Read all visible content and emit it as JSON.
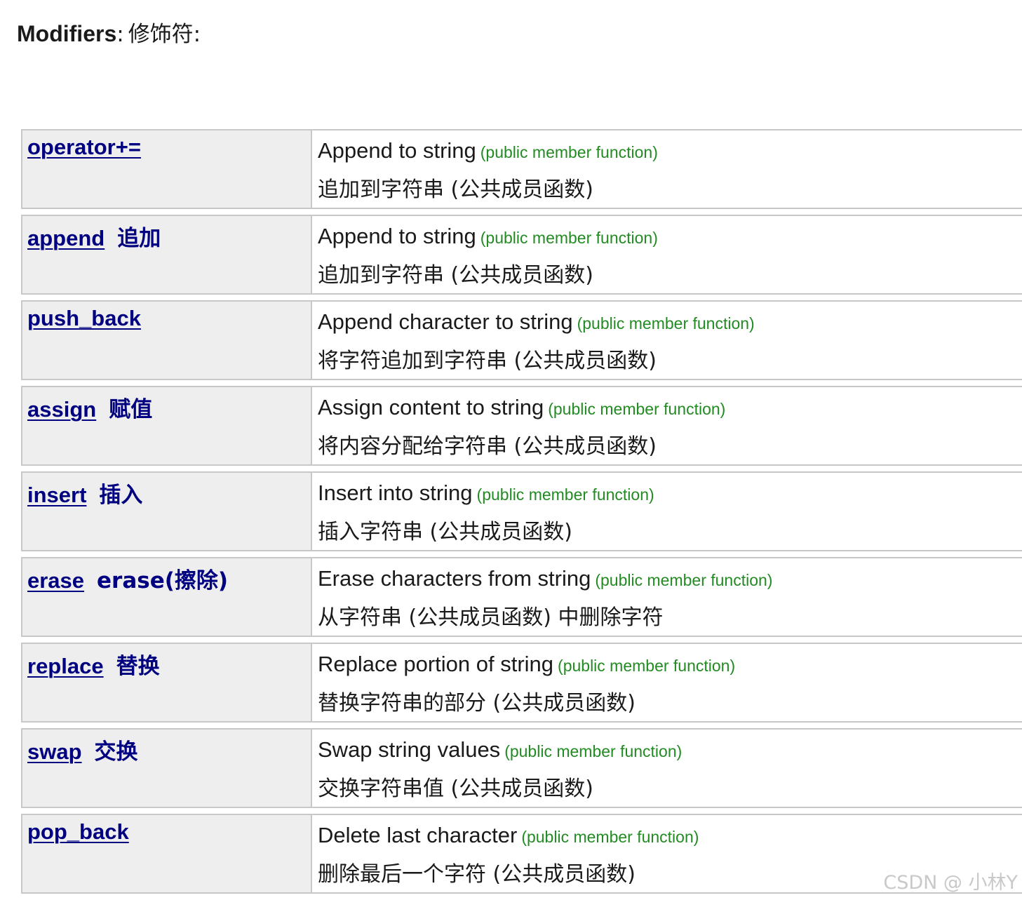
{
  "heading": {
    "label": "Modifiers",
    "separator": ":",
    "chinese": "修饰符:"
  },
  "rows": [
    {
      "name": "operator+=",
      "name_cn": "",
      "desc": "Append to string",
      "kind": "(public member function)",
      "desc_cn": "追加到字符串 (公共成员函数)"
    },
    {
      "name": "append",
      "name_cn": "追加",
      "desc": "Append to string",
      "kind": "(public member function)",
      "desc_cn": "追加到字符串 (公共成员函数)"
    },
    {
      "name": "push_back",
      "name_cn": "",
      "desc": "Append character to string",
      "kind": "(public member function)",
      "desc_cn": "将字符追加到字符串 (公共成员函数)"
    },
    {
      "name": "assign",
      "name_cn": "赋值",
      "desc": "Assign content to string",
      "kind": "(public member function)",
      "desc_cn": "将内容分配给字符串 (公共成员函数)"
    },
    {
      "name": "insert",
      "name_cn": "插入",
      "desc": "Insert into string",
      "kind": "(public member function)",
      "desc_cn": "插入字符串 (公共成员函数)"
    },
    {
      "name": "erase",
      "name_cn": "erase(擦除)",
      "desc": "Erase characters from string",
      "kind": "(public member function)",
      "desc_cn": "从字符串 (公共成员函数) 中删除字符"
    },
    {
      "name": "replace",
      "name_cn": "替换",
      "desc": "Replace portion of string",
      "kind": "(public member function)",
      "desc_cn": "替换字符串的部分 (公共成员函数)"
    },
    {
      "name": "swap",
      "name_cn": "交换",
      "desc": "Swap string values",
      "kind": "(public member function)",
      "desc_cn": "交换字符串值 (公共成员函数)"
    },
    {
      "name": "pop_back",
      "name_cn": "",
      "desc": "Delete last character",
      "kind": "(public member function)",
      "desc_cn": "删除最后一个字符 (公共成员函数)"
    }
  ],
  "watermark": "CSDN @ 小林Y",
  "colors": {
    "link": "#000080",
    "kind": "#228b22",
    "left_bg": "#eeeeee",
    "border": "#c8c8c8"
  }
}
